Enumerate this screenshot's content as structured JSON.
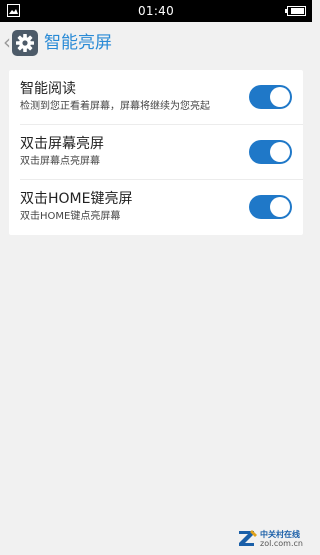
{
  "status_bar": {
    "time": "01:40",
    "left_icon": "image-icon",
    "right_icon": "battery-icon"
  },
  "app_bar": {
    "back_glyph": "‹",
    "icon": "settings-gear-icon",
    "title": "智能亮屏"
  },
  "settings": [
    {
      "label": "智能阅读",
      "description": "检测到您正看着屏幕，屏幕将继续为您亮起",
      "enabled": true
    },
    {
      "label": "双击屏幕亮屏",
      "description": "双击屏幕点亮屏幕",
      "enabled": true
    },
    {
      "label": "双击HOME键亮屏",
      "description": "双击HOME键点亮屏幕",
      "enabled": true
    }
  ],
  "watermark": {
    "top": "中关村在线",
    "bottom": "zol.com.cn"
  },
  "colors": {
    "accent": "#2a8bd6",
    "toggle_on": "#1f78c8",
    "background": "#f1f1f1"
  }
}
